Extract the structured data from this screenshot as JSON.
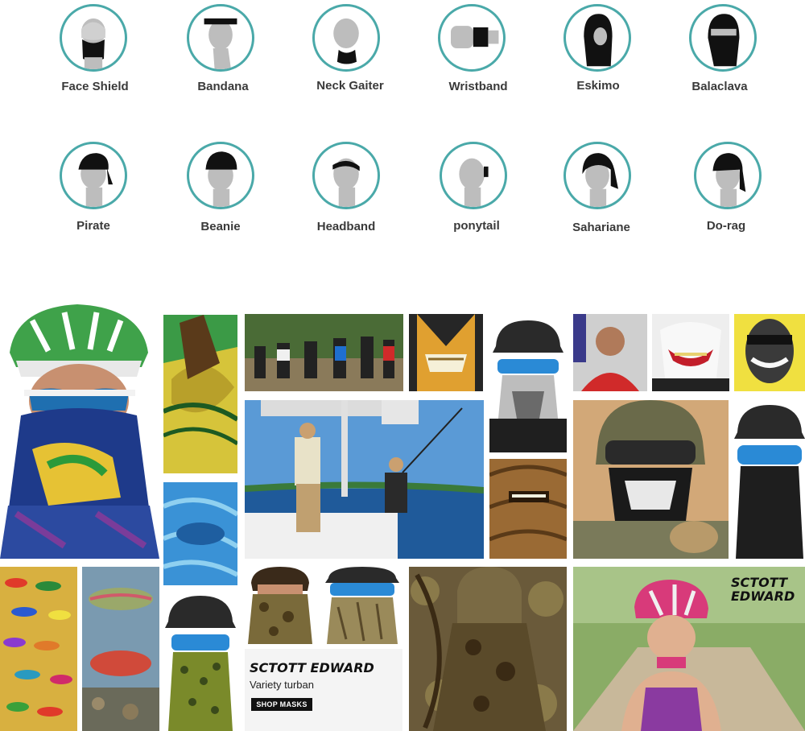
{
  "styles_row1": [
    {
      "label": "Face Shield",
      "icon": "face-shield-icon"
    },
    {
      "label": "Bandana",
      "icon": "bandana-icon"
    },
    {
      "label": "Neck Gaiter",
      "icon": "neck-gaiter-icon"
    },
    {
      "label": "Wristband",
      "icon": "wristband-icon"
    },
    {
      "label": "Eskimo",
      "icon": "eskimo-icon"
    },
    {
      "label": "Balaclava",
      "icon": "balaclava-icon"
    }
  ],
  "styles_row2": [
    {
      "label": "Pirate",
      "icon": "pirate-icon"
    },
    {
      "label": "Beanie",
      "icon": "beanie-icon"
    },
    {
      "label": "Headband",
      "icon": "headband-icon"
    },
    {
      "label": "ponytail",
      "icon": "ponytail-icon"
    },
    {
      "label": "Sahariane",
      "icon": "sahariane-icon"
    },
    {
      "label": "Do-rag",
      "icon": "do-rag-icon"
    }
  ],
  "collage": {
    "promo_brand": "SCTOTT EDWARD",
    "promo_subtitle": "Variety turban",
    "promo_button": "SHOP MASKS",
    "corner_brand_line1": "SCTOTT",
    "corner_brand_line2": "EDWARD"
  },
  "colors": {
    "icon_ring": "#4aa9a9",
    "label_text": "#3a3a3a",
    "accent_dark": "#111111"
  }
}
